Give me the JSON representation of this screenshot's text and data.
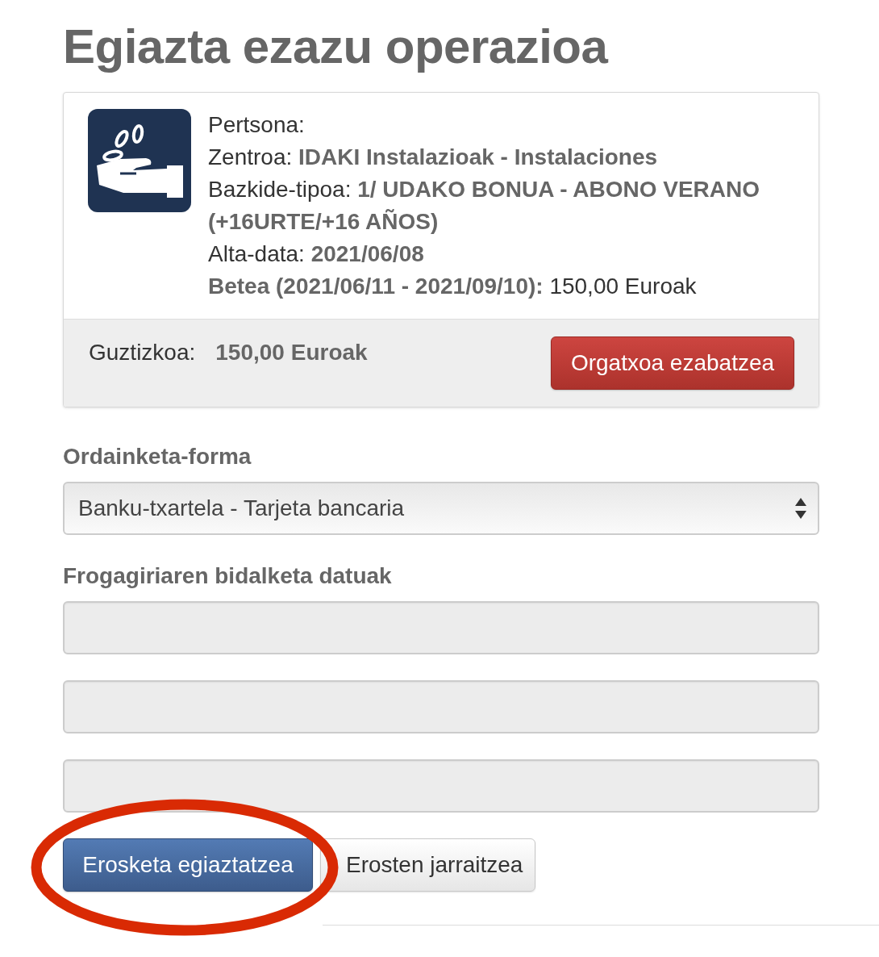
{
  "page_title": "Egiazta ezazu operazioa",
  "summary": {
    "details": [
      "Pertsona:",
      "Zentroa: **IDAKI Instalazioak - Instalaciones**",
      "Bazkide-tipoa: **1/ UDAKO BONUA - ABONO VERANO (+16URTE/+16 AÑOS)**",
      "Alta-data: **2021/06/08**",
      "**Betea (2021/06/11 - 2021/09/10):** 150,00 Euroak"
    ],
    "total_label": "Guztizkoa:",
    "total_value": "150,00 Euroak",
    "remove_button": "Orgatxoa ezabatzea"
  },
  "payment": {
    "label": "Ordainketa-forma",
    "value": "Banku-txartela - Tarjeta bancaria"
  },
  "shipping": {
    "label": "Frogagiriaren bidalketa datuak",
    "fields": [
      {
        "disabled": true
      },
      {
        "disabled": true
      },
      {
        "disabled": true
      }
    ]
  },
  "buttons": [
    {
      "label": "Erosketa egiaztatzea",
      "kind": "primary",
      "highlighted": true
    },
    {
      "label": "Erosten jarraitzea",
      "kind": "default",
      "highlighted": false
    }
  ]
}
